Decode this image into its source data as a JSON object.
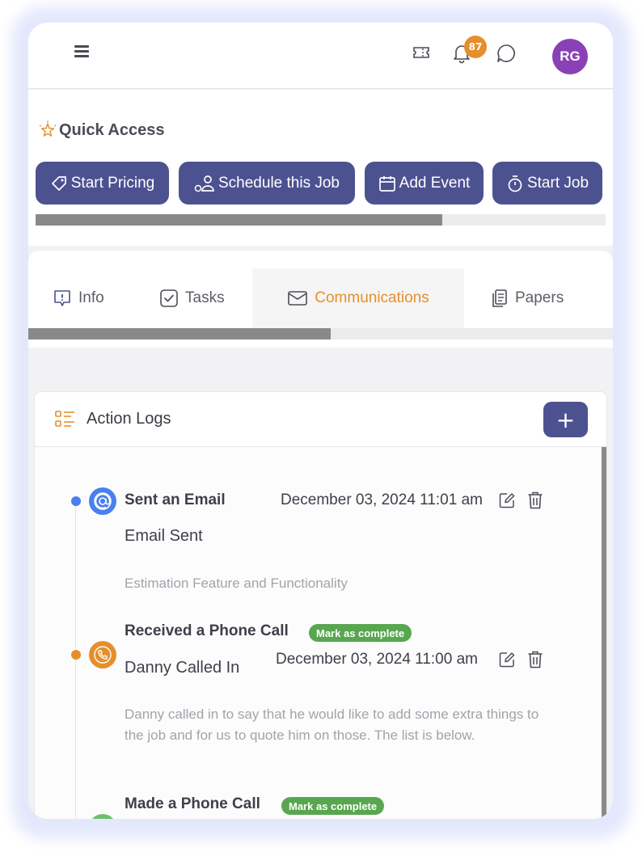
{
  "topbar": {
    "notification_count": "87",
    "avatar_initials": "RG"
  },
  "quick_access": {
    "title": "Quick Access",
    "buttons": [
      {
        "label": "Start Pricing",
        "icon": "tag-icon"
      },
      {
        "label": "Schedule this Job",
        "icon": "schedule-icon"
      },
      {
        "label": "Add Event",
        "icon": "calendar-icon"
      },
      {
        "label": "Start Job",
        "icon": "stopwatch-icon"
      }
    ],
    "scroll_position_fraction": 0.71
  },
  "tabs": {
    "items": [
      {
        "label": "Info",
        "icon": "info-icon"
      },
      {
        "label": "Tasks",
        "icon": "checkbox-icon"
      },
      {
        "label": "Communications",
        "icon": "mail-icon",
        "active": true
      },
      {
        "label": "Papers",
        "icon": "documents-icon"
      }
    ],
    "scroll_position_fraction": 0.52
  },
  "action_logs": {
    "title": "Action Logs",
    "add_label": "+",
    "events": [
      {
        "title": "Sent an Email",
        "date": "December 03, 2024 11:01 am",
        "subtitle": "Email Sent",
        "description": "Estimation Feature and Functionality",
        "type_color": "#4a7ff0",
        "icon": "at-sign-icon"
      },
      {
        "title": "Received a Phone Call",
        "badge": "Mark as complete",
        "date": "December 03, 2024 11:00 am",
        "subtitle": "Danny Called In",
        "description": "Danny called in to say that he would like to add some extra things to the job and for us to quote him on those. The list is below.",
        "type_color": "#e58f2c",
        "icon": "phone-incoming-icon"
      },
      {
        "title": "Made a Phone Call",
        "badge": "Mark as complete",
        "type_color": "#6cc06a",
        "icon": "phone-outgoing-icon"
      }
    ]
  },
  "colors": {
    "primary": "#4c5290",
    "accent": "#e58f2c",
    "success": "#58a74f"
  }
}
